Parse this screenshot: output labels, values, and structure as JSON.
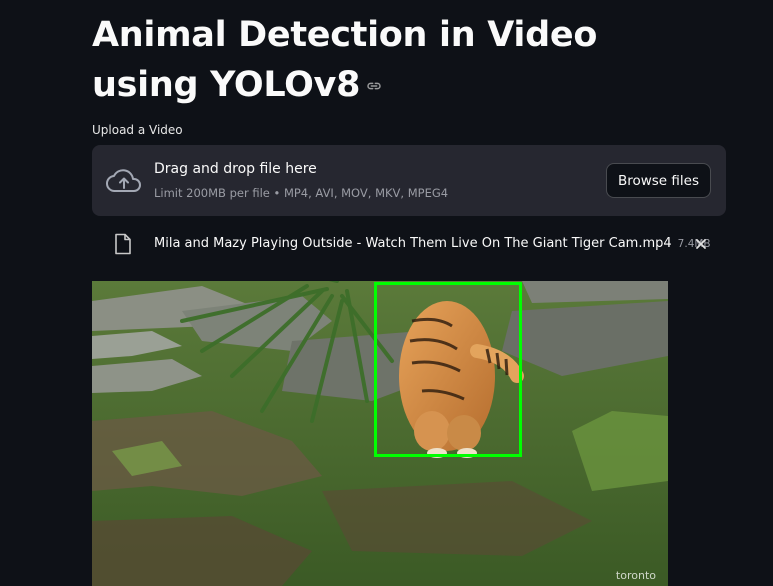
{
  "page": {
    "title": "Animal Detection in Video using YOLOv8",
    "title_link_icon": "link-icon"
  },
  "uploader": {
    "label": "Upload a Video",
    "drop_text": "Drag and drop file here",
    "limit_text": "Limit 200MB per file • MP4, AVI, MOV, MKV, MPEG4",
    "browse_label": "Browse files",
    "upload_icon": "cloud-upload-icon"
  },
  "uploaded_file": {
    "name": "Mila and Mazy Playing Outside - Watch Them Live On The Giant Tiger Cam.mp4",
    "size": "7.4MB",
    "file_icon": "file-icon",
    "remove_icon": "close-icon"
  },
  "video": {
    "watermark": "toronto",
    "detection_color": "#00ff00"
  },
  "colors": {
    "background": "#0e1117",
    "panel": "#262730",
    "text": "#fafafa",
    "muted": "#9a9ca4"
  }
}
